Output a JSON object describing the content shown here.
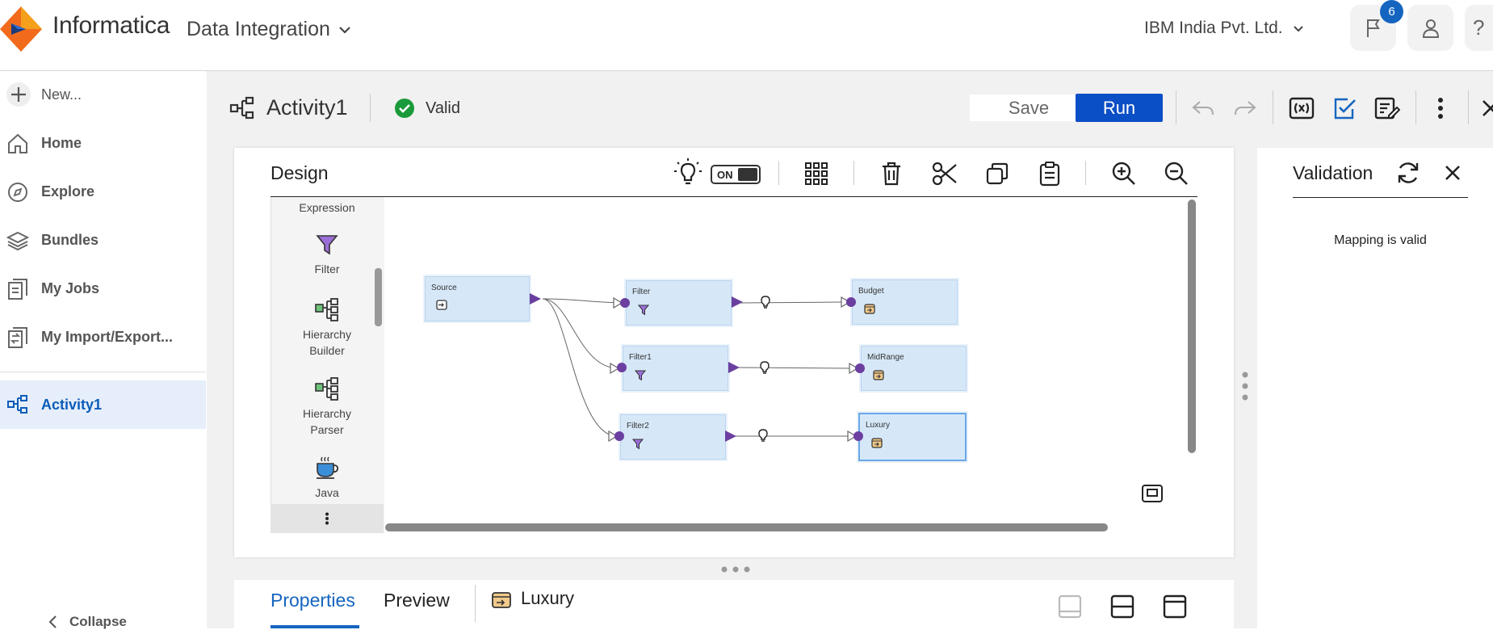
{
  "header": {
    "brand": "Informatica",
    "product": "Data Integration",
    "org": "IBM India Pvt. Ltd.",
    "notification_count": "6",
    "help_icon": "?"
  },
  "sidebar": {
    "new_label": "New...",
    "items": [
      {
        "label": "Home",
        "icon": "home-icon"
      },
      {
        "label": "Explore",
        "icon": "compass-icon"
      },
      {
        "label": "Bundles",
        "icon": "layers-icon"
      },
      {
        "label": "My Jobs",
        "icon": "jobs-icon"
      },
      {
        "label": "My Import/Export...",
        "icon": "import-export-icon"
      }
    ],
    "active_item": "Activity1",
    "collapse_label": "Collapse"
  },
  "toolbar": {
    "title": "Activity1",
    "status": "Valid",
    "save_label": "Save",
    "run_label": "Run"
  },
  "design": {
    "title": "Design",
    "toggle_label": "ON",
    "palette": {
      "items": [
        "Expression",
        "Filter",
        "Hierarchy Builder",
        "Hierarchy Parser",
        "Java"
      ],
      "hb_line1": "Hierarchy",
      "hb_line2": "Builder",
      "hp_line1": "Hierarchy",
      "hp_line2": "Parser"
    },
    "nodes": {
      "source": "Source",
      "filter": "Filter",
      "filter1": "Filter1",
      "filter2": "Filter2",
      "budget": "Budget",
      "midrange": "MidRange",
      "luxury": "Luxury"
    }
  },
  "validation": {
    "title": "Validation",
    "message": "Mapping is valid"
  },
  "properties": {
    "tab_properties": "Properties",
    "tab_preview": "Preview",
    "selected_object": "Luxury"
  },
  "colors": {
    "accent": "#0b4fc6",
    "node_fill": "#d6e8f8",
    "port": "#6b3fa0",
    "valid_green": "#1a9a3a"
  }
}
